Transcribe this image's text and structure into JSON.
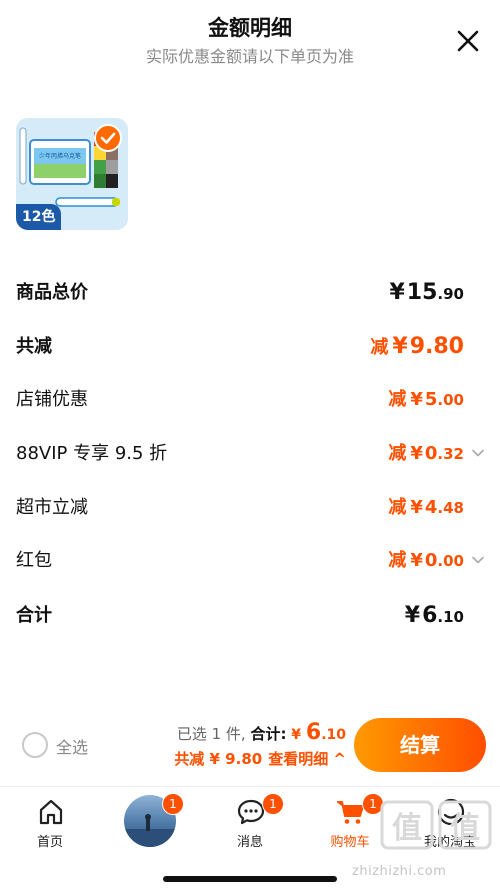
{
  "header": {
    "title": "金额明细",
    "subtitle": "实际优惠金额请以下单页为准"
  },
  "product": {
    "count_badge": "12色",
    "packaging_text": "少年丙烯马克笔"
  },
  "rows": [
    {
      "label": "商品总价",
      "prefix": "",
      "yen": "¥",
      "int": "15",
      "dec": ".90"
    },
    {
      "label": "共减",
      "prefix": "减",
      "yen": "¥",
      "int": "9",
      "dec": ".80"
    },
    {
      "label": "店铺优惠",
      "prefix": "减",
      "yen": "¥",
      "int": "5",
      "dec": ".00"
    },
    {
      "label": "88VIP 专享 9.5 折",
      "prefix": "减",
      "yen": "¥",
      "int": "0",
      "dec": ".32"
    },
    {
      "label": "超市立减",
      "prefix": "减",
      "yen": "¥",
      "int": "4",
      "dec": ".48"
    },
    {
      "label": "红包",
      "prefix": "减",
      "yen": "¥",
      "int": "0",
      "dec": ".00"
    },
    {
      "label": "合计",
      "prefix": "",
      "yen": "¥",
      "int": "6",
      "dec": ".10"
    }
  ],
  "checkout": {
    "select_all": "全选",
    "selected_text": "已选 1 件,",
    "total_label": "合计:",
    "total_yen": "¥",
    "total_int": "6",
    "total_dec": ".10",
    "discount_text": "共减 ¥ 9.80",
    "detail_link": "查看明细 ^",
    "pay_button": "结算"
  },
  "tabs": [
    {
      "label": "首页",
      "icon": "home-icon",
      "badge": ""
    },
    {
      "label": "",
      "icon": "avatar",
      "badge": "1"
    },
    {
      "label": "消息",
      "icon": "message-icon",
      "badge": "1"
    },
    {
      "label": "购物车",
      "icon": "cart-icon",
      "badge": "1"
    },
    {
      "label": "我的淘宝",
      "icon": "profile-icon",
      "badge": ""
    }
  ],
  "watermark": {
    "logo_text": "值",
    "url": "zhizhizhi.com"
  },
  "colors": {
    "accent": "#ff5000",
    "button_start": "#ff9a00",
    "button_end": "#ff4e00"
  }
}
